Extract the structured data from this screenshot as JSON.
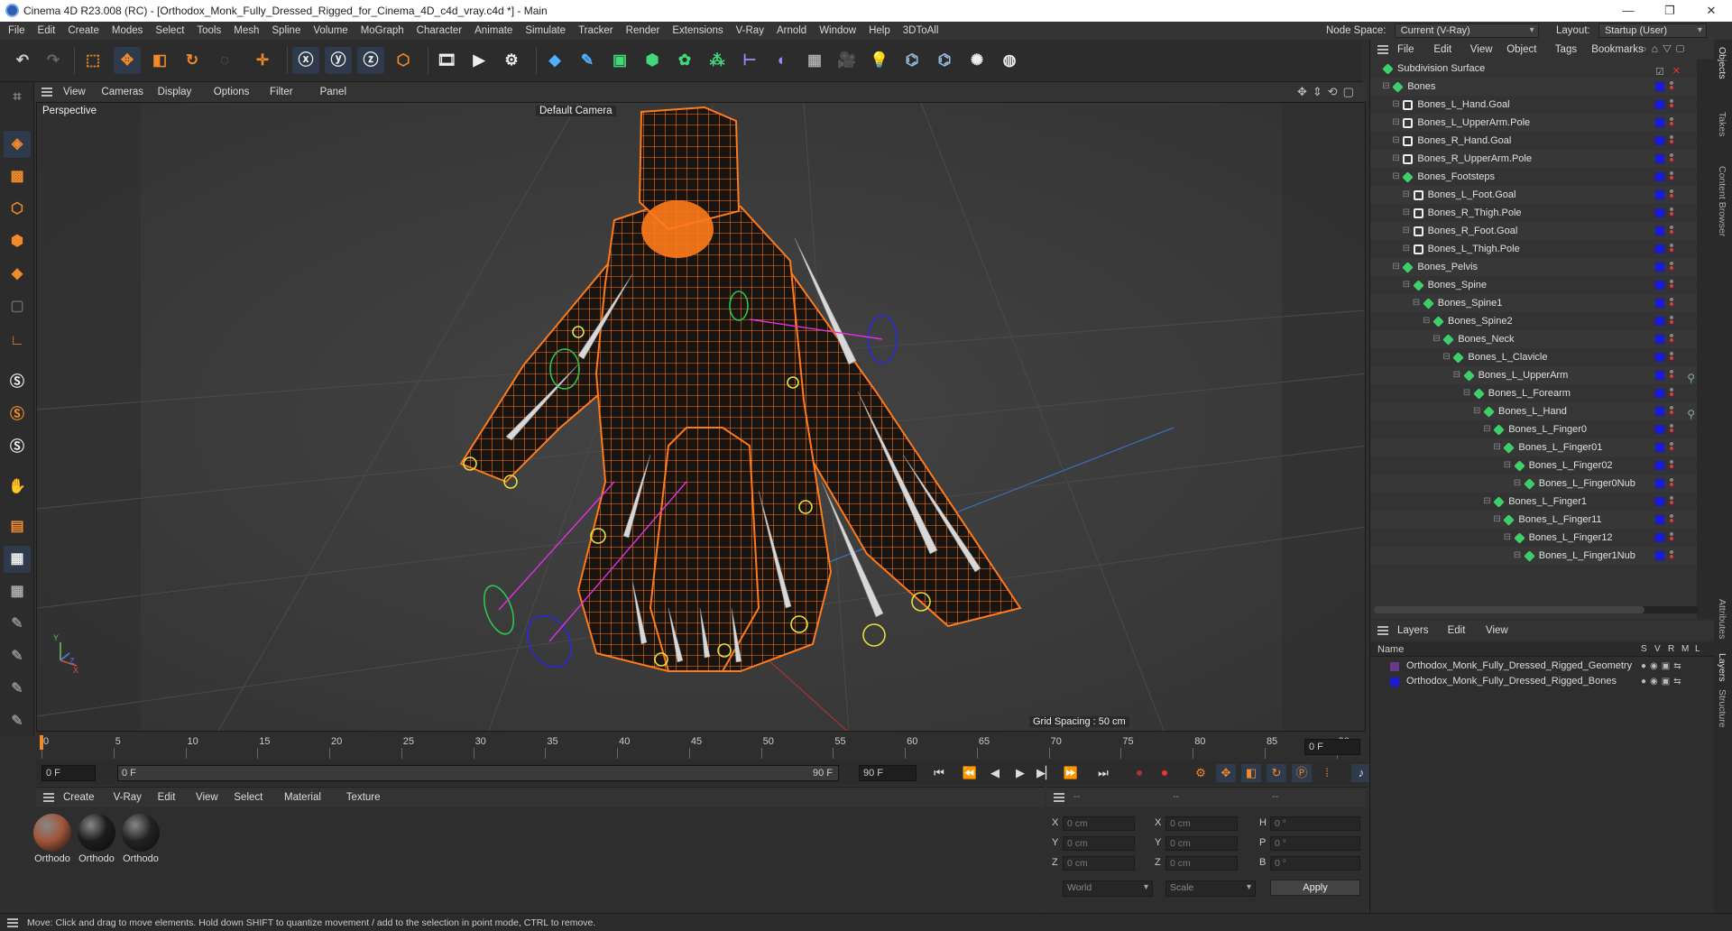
{
  "window": {
    "title": "Cinema 4D R23.008 (RC) - [Orthodox_Monk_Fully_Dressed_Rigged_for_Cinema_4D_c4d_vray.c4d *] - Main",
    "minimize": "—",
    "maximize": "❐",
    "close": "✕"
  },
  "menubar": {
    "items": [
      "File",
      "Edit",
      "Create",
      "Modes",
      "Select",
      "Tools",
      "Mesh",
      "Spline",
      "Volume",
      "MoGraph",
      "Character",
      "Animate",
      "Simulate",
      "Tracker",
      "Render",
      "Extensions",
      "V-Ray",
      "Arnold",
      "Window",
      "Help",
      "3DToAll"
    ],
    "node_space_label": "Node Space:",
    "node_space_value": "Current (V-Ray)",
    "layout_label": "Layout:",
    "layout_value": "Startup (User)"
  },
  "viewport": {
    "menu": [
      "View",
      "Cameras",
      "Display",
      "Options",
      "Filter",
      "Panel"
    ],
    "name": "Perspective",
    "camera": "Default Camera",
    "grid_spacing": "Grid Spacing : 50 cm"
  },
  "timeline": {
    "ticks": [
      "0",
      "5",
      "10",
      "15",
      "20",
      "25",
      "30",
      "35",
      "40",
      "45",
      "50",
      "55",
      "60",
      "65",
      "70",
      "75",
      "80",
      "85",
      "90"
    ],
    "current_frame": "0 F",
    "start_frame": "0 F",
    "range_start": "0 F",
    "range_end": "90 F",
    "end_frame": "90 F"
  },
  "materials": {
    "menu": [
      "Create",
      "V-Ray",
      "Edit",
      "View",
      "Select",
      "Material",
      "Texture"
    ],
    "items": [
      {
        "label": "Orthodo",
        "color": "#a0553a"
      },
      {
        "label": "Orthodo",
        "color": "#1c1c1c"
      },
      {
        "label": "Orthodo",
        "color": "#222222"
      }
    ]
  },
  "attributes": {
    "head": [
      "--",
      "--",
      "--"
    ],
    "rows": [
      {
        "l1": "X",
        "v1": "0 cm",
        "l2": "X",
        "v2": "0 cm",
        "l3": "H",
        "v3": "0 °"
      },
      {
        "l1": "Y",
        "v1": "0 cm",
        "l2": "Y",
        "v2": "0 cm",
        "l3": "P",
        "v3": "0 °"
      },
      {
        "l1": "Z",
        "v1": "0 cm",
        "l2": "Z",
        "v2": "0 cm",
        "l3": "B",
        "v3": "0 °"
      }
    ],
    "coord_mode": "World",
    "scale_mode": "Scale",
    "apply": "Apply"
  },
  "status": "Move: Click and drag to move elements. Hold down SHIFT to quantize movement / add to the selection in point mode, CTRL to remove.",
  "objects": {
    "menu": [
      "File",
      "Edit",
      "View",
      "Object",
      "Tags",
      "Bookmarks"
    ],
    "rows": [
      {
        "name": "Subdivision Surface",
        "indent": 0,
        "type": "subd"
      },
      {
        "name": "Bones",
        "indent": 1,
        "type": "bone"
      },
      {
        "name": "Bones_L_Hand.Goal",
        "indent": 2,
        "type": "null"
      },
      {
        "name": "Bones_L_UpperArm.Pole",
        "indent": 2,
        "type": "null"
      },
      {
        "name": "Bones_R_Hand.Goal",
        "indent": 2,
        "type": "null"
      },
      {
        "name": "Bones_R_UpperArm.Pole",
        "indent": 2,
        "type": "null"
      },
      {
        "name": "Bones_Footsteps",
        "indent": 2,
        "type": "bone"
      },
      {
        "name": "Bones_L_Foot.Goal",
        "indent": 3,
        "type": "null"
      },
      {
        "name": "Bones_R_Thigh.Pole",
        "indent": 3,
        "type": "null"
      },
      {
        "name": "Bones_R_Foot.Goal",
        "indent": 3,
        "type": "null"
      },
      {
        "name": "Bones_L_Thigh.Pole",
        "indent": 3,
        "type": "null"
      },
      {
        "name": "Bones_Pelvis",
        "indent": 2,
        "type": "bone"
      },
      {
        "name": "Bones_Spine",
        "indent": 3,
        "type": "bone"
      },
      {
        "name": "Bones_Spine1",
        "indent": 4,
        "type": "bone"
      },
      {
        "name": "Bones_Spine2",
        "indent": 5,
        "type": "bone"
      },
      {
        "name": "Bones_Neck",
        "indent": 6,
        "type": "bone"
      },
      {
        "name": "Bones_L_Clavicle",
        "indent": 7,
        "type": "bone"
      },
      {
        "name": "Bones_L_UpperArm",
        "indent": 8,
        "type": "bone"
      },
      {
        "name": "Bones_L_Forearm",
        "indent": 9,
        "type": "bone"
      },
      {
        "name": "Bones_L_Hand",
        "indent": 10,
        "type": "bone"
      },
      {
        "name": "Bones_L_Finger0",
        "indent": 11,
        "type": "bone"
      },
      {
        "name": "Bones_L_Finger01",
        "indent": 12,
        "type": "bone"
      },
      {
        "name": "Bones_L_Finger02",
        "indent": 13,
        "type": "bone"
      },
      {
        "name": "Bones_L_Finger0Nub",
        "indent": 14,
        "type": "bone"
      },
      {
        "name": "Bones_L_Finger1",
        "indent": 11,
        "type": "bone"
      },
      {
        "name": "Bones_L_Finger11",
        "indent": 12,
        "type": "bone"
      },
      {
        "name": "Bones_L_Finger12",
        "indent": 13,
        "type": "bone"
      },
      {
        "name": "Bones_L_Finger1Nub",
        "indent": 14,
        "type": "bone"
      }
    ]
  },
  "layers": {
    "menu": [
      "Layers",
      "Edit",
      "View"
    ],
    "col_name": "Name",
    "cols": [
      "S",
      "V",
      "R",
      "M",
      "L"
    ],
    "items": [
      {
        "name": "Orthodox_Monk_Fully_Dressed_Rigged_Geometry",
        "color": "#6a3a8a"
      },
      {
        "name": "Orthodox_Monk_Fully_Dressed_Rigged_Bones",
        "color": "#1a1ad8"
      }
    ]
  },
  "side_tabs": [
    "Objects",
    "Takes",
    "Content Browser",
    "Attributes",
    "Layers",
    "Structure"
  ],
  "colors": {
    "accent_orange": "#ff7a1a",
    "selected_blue": "#2f3b4c",
    "bone_green": "#2fa84f"
  }
}
